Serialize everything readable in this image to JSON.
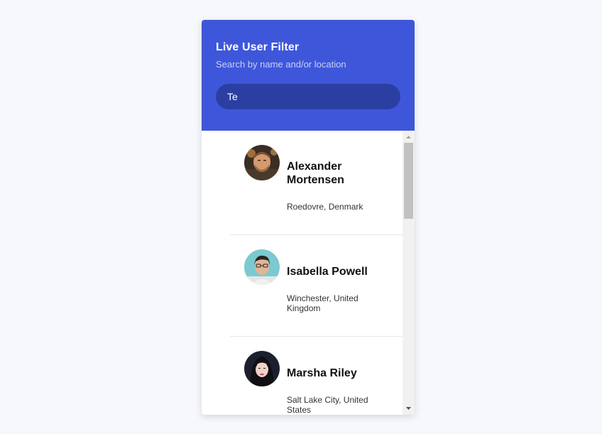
{
  "header": {
    "title": "Live User Filter",
    "subtitle": "Search by name and/or location",
    "search_value": "Te",
    "header_color": "#3e57da",
    "search_bg_color": "#2b3fa3"
  },
  "users": [
    {
      "name": "Alexander Mortensen",
      "location": "Roedovre, Denmark",
      "avatar_icon": "avatar-photo-man-bearded"
    },
    {
      "name": "Isabella Powell",
      "location": "Winchester, United Kingdom",
      "avatar_icon": "avatar-photo-woman-glasses"
    },
    {
      "name": "Marsha Riley",
      "location": "Salt Lake City, United States",
      "avatar_icon": "avatar-photo-woman-dark"
    }
  ],
  "scrollbar": {
    "up_icon": "triangle-up-icon",
    "down_icon": "triangle-down-icon"
  }
}
